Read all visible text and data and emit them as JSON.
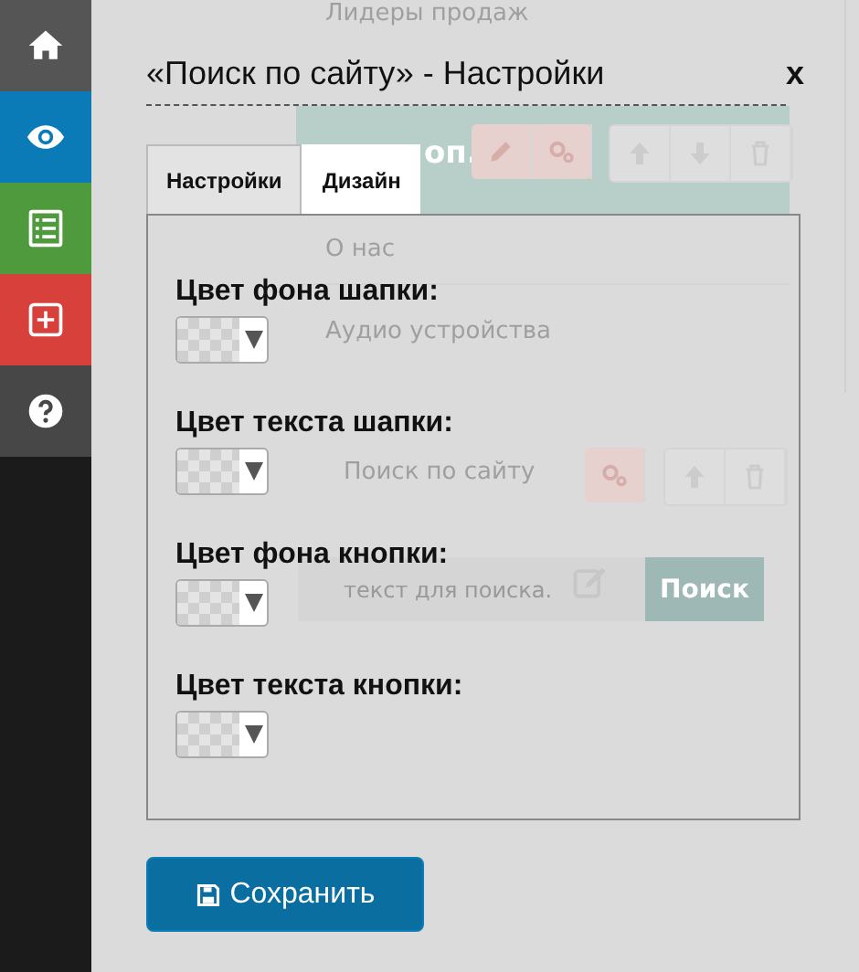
{
  "sidebar": {
    "items": [
      {
        "kind": "home",
        "color": "#555555"
      },
      {
        "kind": "eye",
        "color": "#0b7bb7"
      },
      {
        "kind": "list",
        "color": "#4f9a3c"
      },
      {
        "kind": "plus",
        "color": "#d8403b"
      },
      {
        "kind": "help",
        "color": "#474747"
      }
    ]
  },
  "background_page": {
    "heading": "Лидеры продаж",
    "block_label": "оп.",
    "menu_items": [
      "О нас",
      "Аудио устройства"
    ],
    "widget_title": "Поиск по сайту",
    "search_placeholder": "текст для поиска.",
    "search_button": "Поиск"
  },
  "dialog": {
    "title": "«Поиск по сайту» - Настройки",
    "close": "x",
    "tabs": [
      {
        "label": "Настройки",
        "selected": false
      },
      {
        "label": "Дизайн",
        "selected": true
      }
    ],
    "fields": [
      {
        "label": "Цвет фона шапки:"
      },
      {
        "label": "Цвет текста шапки:"
      },
      {
        "label": "Цвет фона кнопки:"
      },
      {
        "label": "Цвет текста кнопки:"
      }
    ],
    "save_button": "Сохранить"
  }
}
